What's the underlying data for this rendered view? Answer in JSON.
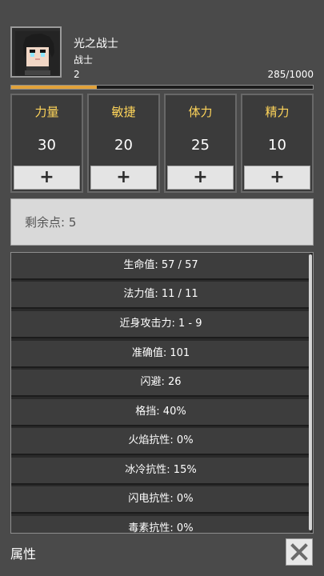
{
  "character": {
    "name": "光之战士",
    "class": "战士",
    "level": "2",
    "exp_text": "285/1000",
    "exp_fraction": 0.285
  },
  "stats": [
    {
      "label": "力量",
      "value": "30",
      "add": "+"
    },
    {
      "label": "敏捷",
      "value": "20",
      "add": "+"
    },
    {
      "label": "体力",
      "value": "25",
      "add": "+"
    },
    {
      "label": "精力",
      "value": "10",
      "add": "+"
    }
  ],
  "remaining_points": "剩余点: 5",
  "details": [
    "生命值: 57 / 57",
    "法力值: 11 / 11",
    "近身攻击力: 1 - 9",
    "准确值: 101",
    "闪避: 26",
    "格挡: 40%",
    "火焰抗性: 0%",
    "冰冷抗性: 15%",
    "闪电抗性: 0%",
    "毒素抗性: 0%"
  ],
  "footer": {
    "title": "属性",
    "close_icon": "close-icon"
  },
  "colors": {
    "background": "#4a4a4a",
    "stat_label": "#ffd55a",
    "exp_fill": "#e2a23a"
  }
}
